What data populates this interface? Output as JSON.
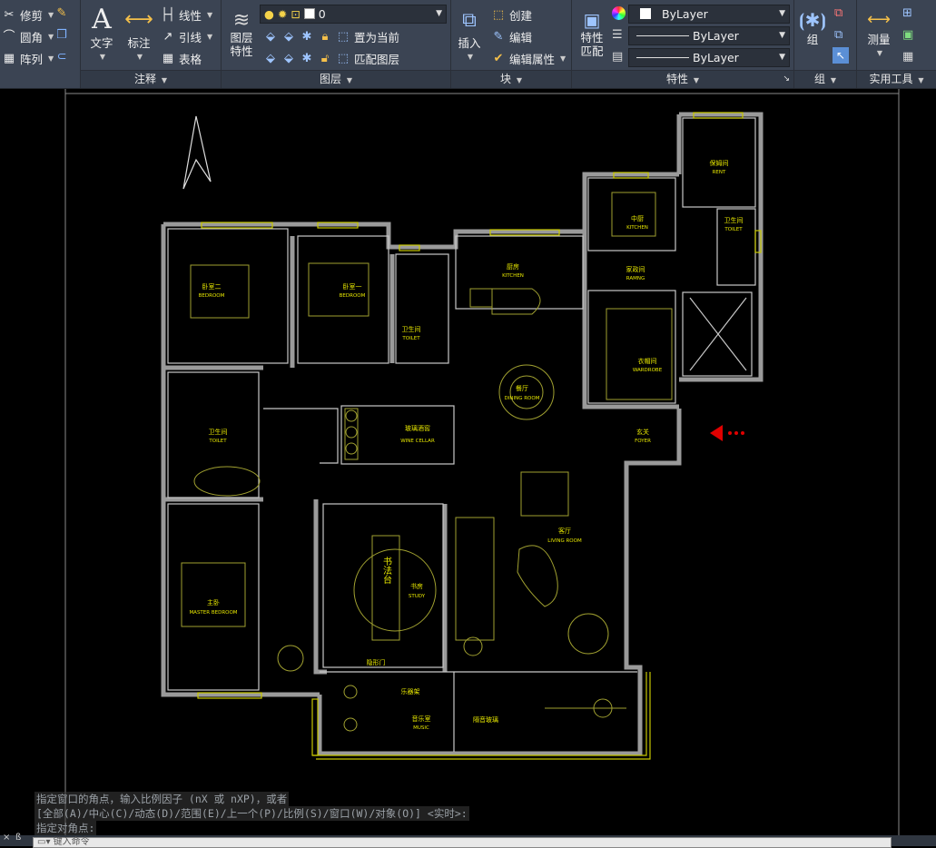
{
  "ribbon": {
    "modify": {
      "trim": "修剪",
      "fillet": "圆角",
      "array": "阵列"
    },
    "annotation": {
      "title": "注释",
      "text": "文字",
      "dimension": "标注",
      "linear": "线性",
      "leader": "引线",
      "table": "表格"
    },
    "layers": {
      "title": "图层",
      "properties": "图层\n特性",
      "layer_value": "0",
      "set_current": "置为当前",
      "match_layer": "匹配图层"
    },
    "block": {
      "title": "块",
      "insert": "插入",
      "create": "创建",
      "edit": "编辑",
      "edit_attr": "编辑属性"
    },
    "properties": {
      "title": "特性",
      "match": "特性\n匹配",
      "color": "ByLayer",
      "linetype": "ByLayer",
      "lineweight": "ByLayer"
    },
    "groups": {
      "title": "组",
      "group": "组"
    },
    "utilities": {
      "title": "实用工具",
      "measure": "测量"
    }
  },
  "rooms": [
    {
      "cn": "卧室二",
      "en": "BEDROOM"
    },
    {
      "cn": "卧室一",
      "en": "BEDROOM"
    },
    {
      "cn": "卫生间",
      "en": "TOILET"
    },
    {
      "cn": "厨房",
      "en": "KITCHEN"
    },
    {
      "cn": "中厨",
      "en": "KITCHEN"
    },
    {
      "cn": "家政间",
      "en": "RAMNG"
    },
    {
      "cn": "保姆间",
      "en": "RENT"
    },
    {
      "cn": "卫生间",
      "en": "TOILET"
    },
    {
      "cn": "餐厅",
      "en": "DINING ROOM"
    },
    {
      "cn": "衣帽间",
      "en": "WARDROBE"
    },
    {
      "cn": "卫生间",
      "en": "TOILET"
    },
    {
      "cn": "玻璃酒窖",
      "en": "WINE CELLAR"
    },
    {
      "cn": "玄关",
      "en": "FOYER"
    },
    {
      "cn": "客厅",
      "en": "LIVING ROOM"
    },
    {
      "cn": "主卧",
      "en": "MASTER BEDROOM"
    },
    {
      "cn": "书房",
      "en": "STUDY"
    },
    {
      "cn": "书法台",
      "en": ""
    },
    {
      "cn": "隐形门",
      "en": ""
    },
    {
      "cn": "乐器架",
      "en": ""
    },
    {
      "cn": "音乐室",
      "en": "MUSIC"
    },
    {
      "cn": "隔音玻璃",
      "en": ""
    }
  ],
  "command": {
    "line1": "指定窗口的角点，输入比例因子 (nX 或 nXP)，或者",
    "line2": "[全部(A)/中心(C)/动态(D)/范围(E)/上一个(P)/比例(S)/窗口(W)/对象(O)] <实时>:",
    "line3": "指定对角点:",
    "input_placeholder": "键入命令"
  },
  "colors": {
    "accent": "#e6e600",
    "wall": "#9a9a9a",
    "entry_arrow": "#e00000"
  }
}
